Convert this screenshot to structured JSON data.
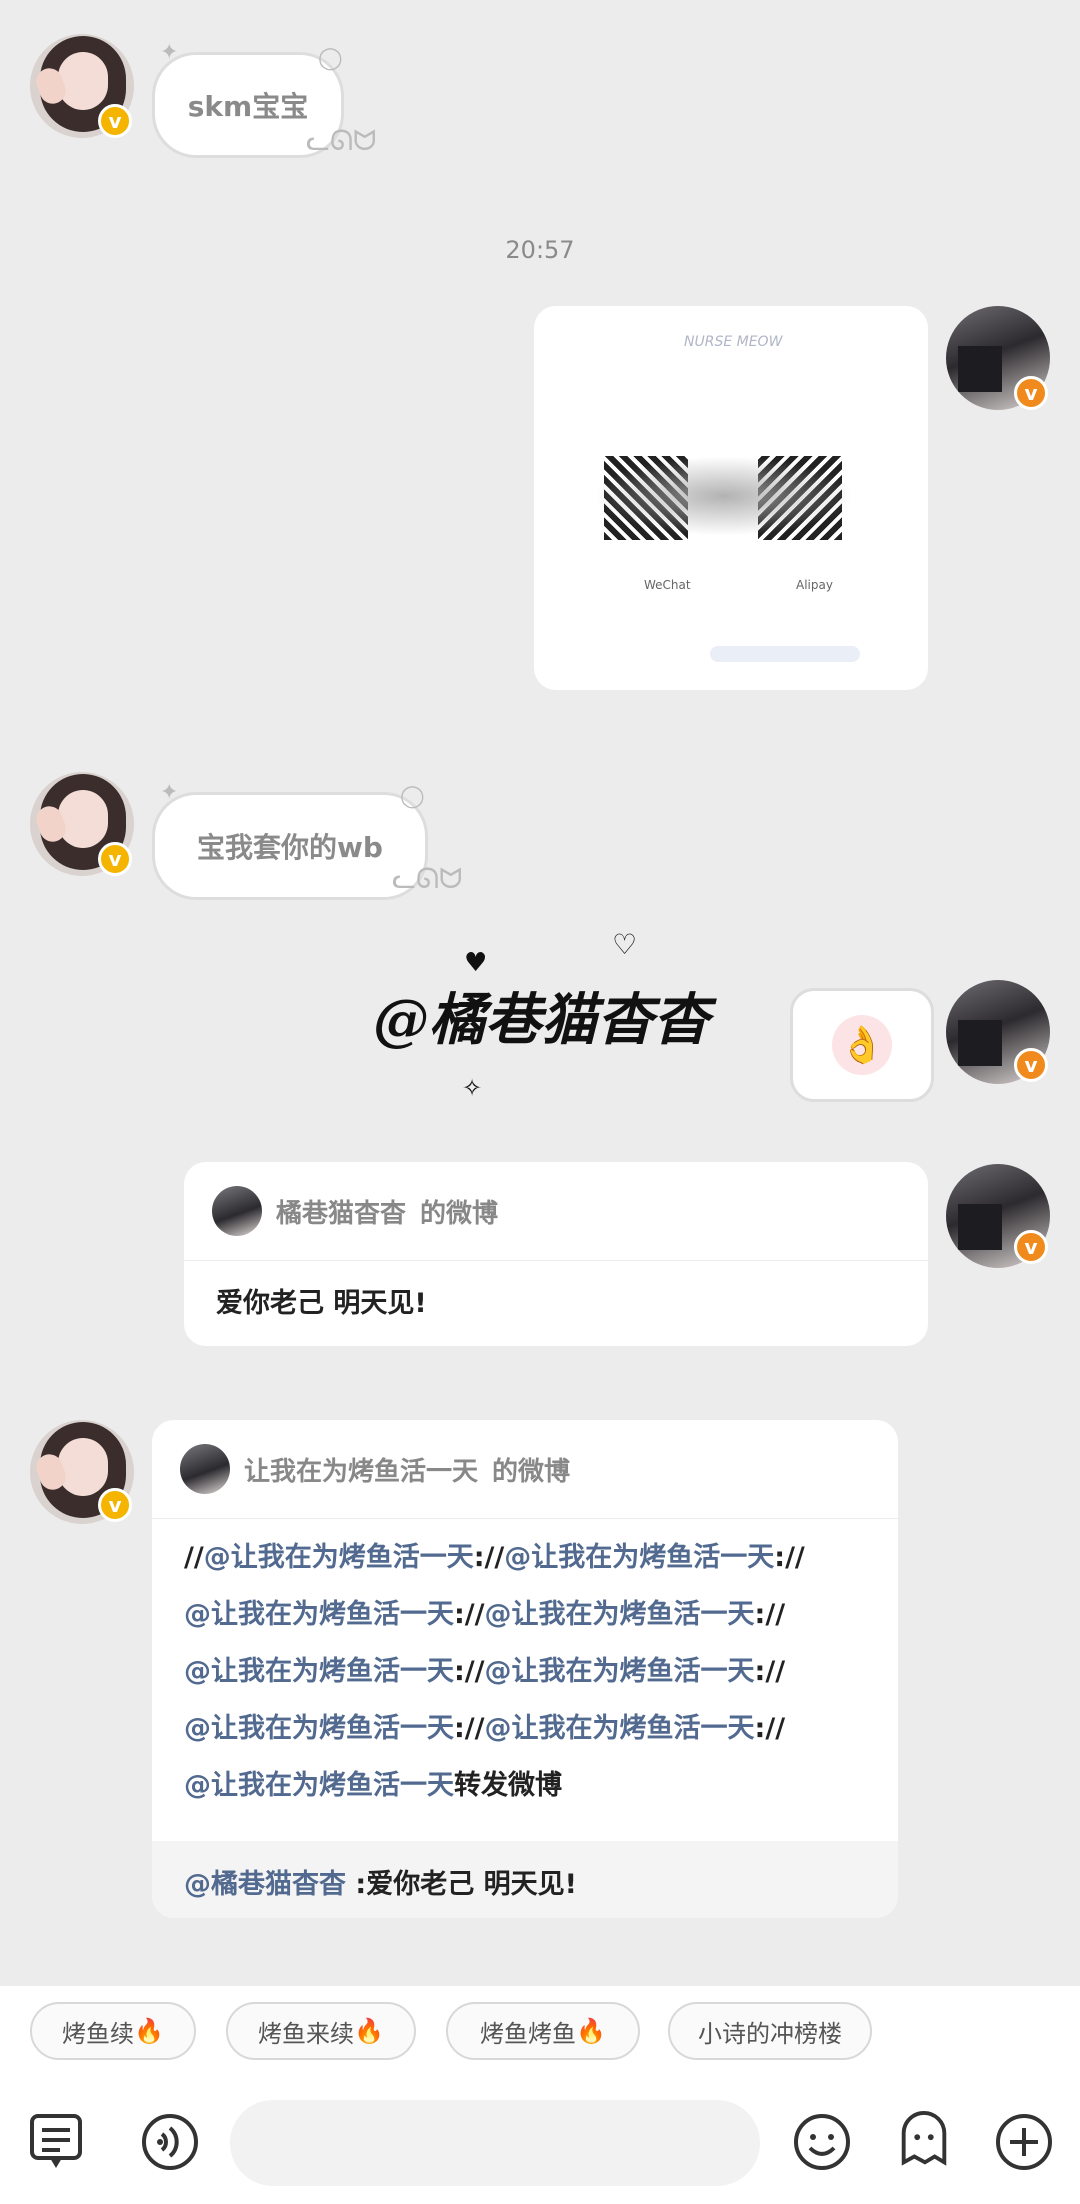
{
  "messages": {
    "m1_text": "skm宝宝",
    "timestamp": "20:57",
    "m3_text": "宝我套你的wb",
    "sticker_text": "@橘巷猫杳杳",
    "share1": {
      "author": "橘巷猫杳杳",
      "suffix": "的微博",
      "content": "爱你老己  明天见!"
    },
    "share2": {
      "author": "让我在为烤鱼活一天",
      "suffix": "的微博",
      "line_prefix": "//",
      "mention": "@让我在为烤鱼活一天",
      "sep": "://",
      "end_text": "转发微博",
      "quote_mention": "@橘巷猫杳杳",
      "quote_text": " :爱你老己  明天见!"
    },
    "qr_labels": {
      "title": "NURSE MEOW",
      "wechat": "WeChat",
      "alipay": "Alipay"
    }
  },
  "quick_replies": [
    {
      "label": "烤鱼续",
      "icon": "🔥"
    },
    {
      "label": "烤鱼来续",
      "icon": "🔥"
    },
    {
      "label": "烤鱼烤鱼",
      "icon": "🔥"
    },
    {
      "label": "小诗的冲榜楼",
      "icon": ""
    }
  ],
  "colors": {
    "background": "#ececec",
    "mention": "#526a8f",
    "badge_yellow": "#f5b400",
    "badge_orange": "#f18a1c"
  },
  "icons": [
    "menu-icon",
    "voice-icon",
    "emoji-icon",
    "sticker-icon",
    "plus-icon"
  ]
}
